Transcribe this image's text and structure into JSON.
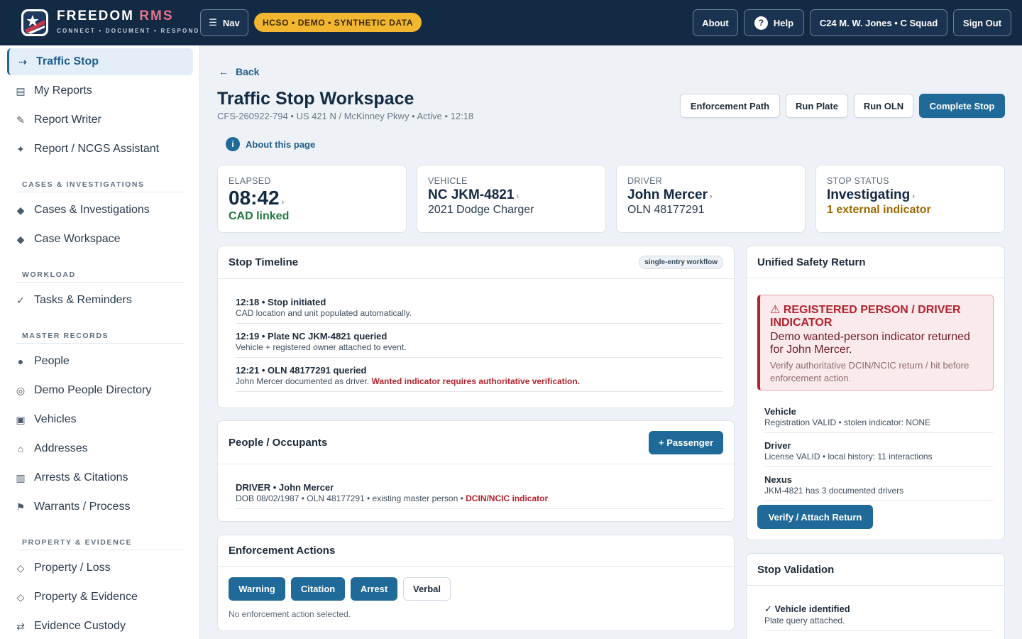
{
  "header": {
    "brand_name": "FREEDOM",
    "brand_accent": "RMS",
    "brand_tagline": "CONNECT • DOCUMENT • RESPOND",
    "nav_label": "Nav",
    "demo_badge": "HCSO • DEMO • SYNTHETIC DATA",
    "about_label": "About",
    "help_label": "Help",
    "user_label": "C24 M. W. Jones • C Squad",
    "signout_label": "Sign Out"
  },
  "sidebar": {
    "top_items": [
      {
        "label": "Traffic Stop",
        "icon": "arrow-right-icon"
      },
      {
        "label": "My Reports",
        "icon": "document-icon"
      },
      {
        "label": "Report Writer",
        "icon": "pencil-icon"
      },
      {
        "label": "Report / NCGS Assistant",
        "icon": "sparkle-icon"
      }
    ],
    "sections": [
      {
        "heading": "CASES & INVESTIGATIONS",
        "items": [
          {
            "label": "Cases & Investigations"
          },
          {
            "label": "Case Workspace"
          }
        ]
      },
      {
        "heading": "WORKLOAD",
        "items": [
          {
            "label": "Tasks & Reminders"
          }
        ]
      },
      {
        "heading": "MASTER RECORDS",
        "items": [
          {
            "label": "People"
          },
          {
            "label": "Demo People Directory"
          },
          {
            "label": "Vehicles"
          },
          {
            "label": "Addresses"
          },
          {
            "label": "Arrests & Citations"
          },
          {
            "label": "Warrants / Process"
          }
        ]
      },
      {
        "heading": "PROPERTY & EVIDENCE",
        "items": [
          {
            "label": "Property / Loss"
          },
          {
            "label": "Property & Evidence"
          },
          {
            "label": "Evidence Custody"
          }
        ]
      }
    ]
  },
  "page": {
    "back_label": "Back",
    "title": "Traffic Stop Workspace",
    "subtitle": "CFS-260922-794 • US 421 N / McKinney Pkwy • Active • 12:18",
    "about_label": "About this page",
    "actions": {
      "enforcement_path": "Enforcement Path",
      "run_plate": "Run Plate",
      "run_oln": "Run OLN",
      "complete_stop": "Complete Stop"
    }
  },
  "stats": [
    {
      "label": "ELAPSED",
      "value": "08:42",
      "extra": "CAD linked"
    },
    {
      "label": "VEHICLE",
      "value": "NC JKM-4821",
      "extra": "2021 Dodge Charger"
    },
    {
      "label": "DRIVER",
      "value": "John Mercer",
      "extra": "OLN 48177291"
    },
    {
      "label": "STOP STATUS",
      "value": "Investigating",
      "extra": "1 external indicator"
    }
  ],
  "timeline": {
    "title": "Stop Timeline",
    "tag": "single-entry workflow",
    "events": [
      {
        "title": "12:18 • Stop initiated",
        "detail": "CAD location and unit populated automatically.",
        "alert": ""
      },
      {
        "title": "12:19 • Plate NC JKM-4821 queried",
        "detail": "Vehicle + registered owner attached to event.",
        "alert": ""
      },
      {
        "title": "12:21 • OLN 48177291 queried",
        "detail": "John Mercer documented as driver.",
        "alert": "Wanted indicator requires authoritative verification."
      }
    ]
  },
  "occupants": {
    "title": "People / Occupants",
    "add_label": "+ Passenger",
    "items": [
      {
        "title": "DRIVER • John Mercer",
        "detail": "DOB 08/02/1987 • OLN 48177291 • existing master person •",
        "alert": "DCIN/NCIC indicator"
      }
    ]
  },
  "enforcement": {
    "title": "Enforcement Actions",
    "buttons": [
      "Warning",
      "Citation",
      "Arrest",
      "Verbal"
    ],
    "status": "No enforcement action selected."
  },
  "safety": {
    "title": "Unified Safety Return",
    "alert_title": "⚠ REGISTERED PERSON / DRIVER INDICATOR",
    "alert_body": "Demo wanted-person indicator returned for John Mercer.",
    "alert_note": "Verify authoritative DCIN/NCIC return / hit before enforcement action.",
    "items": [
      {
        "title": "Vehicle",
        "detail": "Registration VALID • stolen indicator: NONE"
      },
      {
        "title": "Driver",
        "detail": "License VALID • local history: 11 interactions"
      },
      {
        "title": "Nexus",
        "detail": "JKM-4821 has 3 documented drivers"
      }
    ],
    "verify_label": "Verify / Attach Return"
  },
  "validation": {
    "title": "Stop Validation",
    "items": [
      {
        "title": "✓ Vehicle identified",
        "detail": "Plate query attached."
      }
    ]
  },
  "colors": {
    "header_bg": "#132a44",
    "primary": "#1f6a99",
    "demo_badge": "#f2b630",
    "alert_red": "#b3232e",
    "ok_green": "#237a3e",
    "warn_amber": "#9a6a00"
  }
}
